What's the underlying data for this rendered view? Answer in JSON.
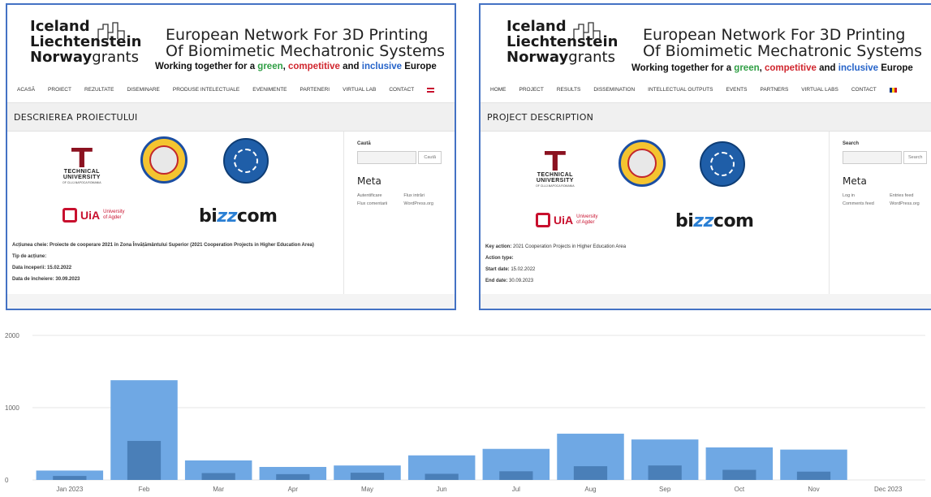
{
  "shots": {
    "ro": {
      "brand": {
        "iceland": "Iceland",
        "liechtenstein": "Liechtenstein",
        "norway": "Norway",
        "grants": "grants"
      },
      "tagline": {
        "line1": "European Network For 3D Printing",
        "line2": "Of Biomimetic Mechatronic Systems",
        "sub_pre": "Working together for a ",
        "green": "green",
        "sep1": ", ",
        "competitive": "competitive",
        "sep2": " and ",
        "inclusive": "inclusive",
        "post": " Europe"
      },
      "nav": [
        "ACASĂ",
        "PROIECT",
        "REZULTATE",
        "DISEMINARE",
        "PRODUSE INTELECTUALE",
        "EVENIMENTE",
        "PARTENERI",
        "VIRTUAL LAB",
        "CONTACT"
      ],
      "language_flag": "uk-flag",
      "page_title": "DESCRIEREA PROIECTULUI",
      "sidebar": {
        "search_label": "Caută",
        "search_button": "Caută",
        "meta_title": "Meta",
        "meta_links": [
          "Autentificare",
          "Flux intrări",
          "Flux comentarii",
          "WordPress.org"
        ]
      },
      "logos": {
        "tu_name_1": "TECHNICAL",
        "tu_name_2": "UNIVERSITY",
        "tu_sub": "OF CLUJ-NAPOCA ROMANIA",
        "uia": "UiA",
        "uia_sub_1": "University",
        "uia_sub_2": "of Agder",
        "bizcom_pre": "bi",
        "bizcom_zz": "zz",
        "bizcom_post": "com"
      },
      "details": {
        "key_action_label": "Acțiunea cheie:",
        "key_action_value": " Proiecte de cooperare 2021 în Zona Învățământului Superior (2021 Cooperation Projects in Higher Education Area)",
        "action_type_label": "Tip de acțiune:",
        "start_label": "Data începerii:",
        "start_value": " 15.02.2022",
        "end_label": "Data de încheiere:",
        "end_value": " 30.09.2023"
      }
    },
    "en": {
      "brand": {
        "iceland": "Iceland",
        "liechtenstein": "Liechtenstein",
        "norway": "Norway",
        "grants": "grants"
      },
      "tagline": {
        "line1": "European Network For 3D Printing",
        "line2": "Of Biomimetic Mechatronic Systems",
        "sub_pre": "Working together for a ",
        "green": "green",
        "sep1": ", ",
        "competitive": "competitive",
        "sep2": " and ",
        "inclusive": "inclusive",
        "post": " Europe"
      },
      "nav": [
        "HOME",
        "PROJECT",
        "RESULTS",
        "DISSEMINATION",
        "INTELLECTUAL OUTPUTS",
        "EVENTS",
        "PARTNERS",
        "VIRTUAL LABS",
        "CONTACT"
      ],
      "language_flag": "ro-flag",
      "page_title": "PROJECT DESCRIPTION",
      "sidebar": {
        "search_label": "Search",
        "search_button": "Search",
        "meta_title": "Meta",
        "meta_links": [
          "Log in",
          "Entries feed",
          "Comments feed",
          "WordPress.org"
        ]
      },
      "logos": {
        "tu_name_1": "TECHNICAL",
        "tu_name_2": "UNIVERSITY",
        "tu_sub": "OF CLUJ-NAPOCA ROMANIA",
        "uia": "UiA",
        "uia_sub_1": "University",
        "uia_sub_2": "of Agder",
        "bizcom_pre": "bi",
        "bizcom_zz": "zz",
        "bizcom_post": "com"
      },
      "details": {
        "key_action_label": "Key action:",
        "key_action_value": " 2021 Cooperation Projects in Higher Education Area",
        "action_type_label": "Action type:",
        "start_label": "Start date:",
        "start_value": " 15.02.2022",
        "end_label": "End date:",
        "end_value": " 30.09.2023"
      }
    }
  },
  "colors": {
    "frame_border": "#4472c4",
    "bar_light": "#6fa8e4",
    "bar_dark": "#4a7fb8",
    "grid": "#e6e6e6"
  },
  "chart_data": {
    "type": "bar",
    "categories": [
      "Jan 2023",
      "Feb",
      "Mar",
      "Apr",
      "May",
      "Jun",
      "Jul",
      "Aug",
      "Sep",
      "Oct",
      "Nov",
      "Dec 2023"
    ],
    "series": [
      {
        "values": [
          130,
          1380,
          270,
          180,
          200,
          340,
          430,
          640,
          560,
          450,
          420,
          0
        ]
      },
      {
        "values": [
          55,
          540,
          95,
          80,
          100,
          85,
          120,
          190,
          200,
          140,
          115,
          0
        ]
      }
    ],
    "y_ticks": [
      0,
      1000,
      2000
    ],
    "ylim": [
      0,
      2000
    ],
    "grid": true,
    "overlapping_series": true
  }
}
